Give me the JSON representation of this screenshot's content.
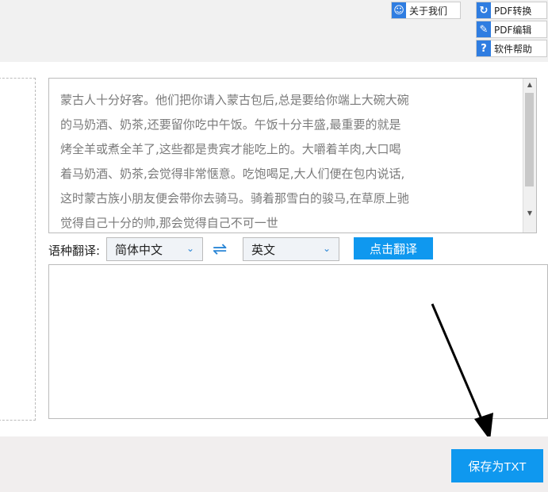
{
  "toolbar": {
    "about": "关于我们",
    "pdf_convert": "PDF转换",
    "pdf_edit": "PDF编辑",
    "help": "软件帮助"
  },
  "source_text": "蒙古人十分好客。他们把你请入蒙古包后,总是要给你端上大碗大碗\n的马奶酒、奶茶,还要留你吃中午饭。午饭十分丰盛,最重要的就是\n烤全羊或煮全羊了,这些都是贵宾才能吃上的。大嚼着羊肉,大口喝\n着马奶酒、奶茶,会觉得非常惬意。吃饱喝足,大人们便在包内说话,\n这时蒙古族小朋友便会带你去骑马。骑着那雪白的骏马,在草原上驰\n觉得自己十分的帅,那会觉得自己不可一世",
  "translate": {
    "label": "语种翻译:",
    "from": "简体中文",
    "to": "英文",
    "button": "点击翻译"
  },
  "output_text": "",
  "save_button": "保存为TXT"
}
